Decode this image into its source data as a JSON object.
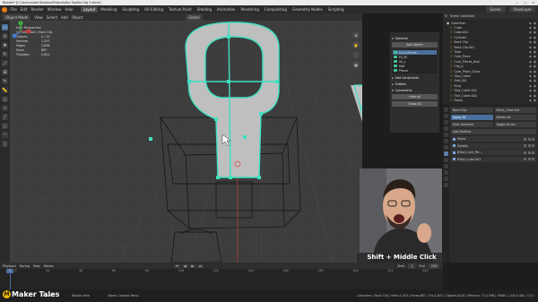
{
  "titlebar": {
    "title": "Blender* [C:\\Users\\maker\\Dropbox\\Projects\\Key Tag\\Key Tag 2.blend]",
    "controls": [
      "—",
      "▢",
      "✕"
    ]
  },
  "menubar": {
    "menus": [
      "File",
      "Edit",
      "Render",
      "Window",
      "Help"
    ],
    "workspaces": [
      "Layout",
      "Modeling",
      "Sculpting",
      "UV Editing",
      "Texture Paint",
      "Shading",
      "Animation",
      "Rendering",
      "Compositing",
      "Geometry Nodes",
      "Scripting"
    ],
    "active_workspace": "Layout",
    "scene_label": "Scene",
    "view_layer_label": "ViewLayer"
  },
  "viewport_header": {
    "mode": "Object Mode",
    "menus": [
      "View",
      "Select",
      "Add",
      "Object"
    ],
    "orientation": "Global"
  },
  "viewport": {
    "view_name": "User Perspective",
    "collection": "(1) Collection | Back Clip",
    "stats": [
      {
        "label": "Objects",
        "value": "0 / 10"
      },
      {
        "label": "Vertices",
        "value": "1,553"
      },
      {
        "label": "Edges",
        "value": "2,636"
      },
      {
        "label": "Faces",
        "value": "887"
      },
      {
        "label": "Triangles",
        "value": "2,622"
      }
    ],
    "nav_buttons": [
      "⊕",
      "✋",
      "🎥",
      "▦"
    ],
    "gizmo_axes": [
      "X",
      "Y",
      "Z"
    ]
  },
  "sketch_panel": {
    "header": "Sketcher",
    "add_button": "Add Sketch",
    "sketches": [
      {
        "name": "Cure_Pieces",
        "color": "#3fbf8f",
        "selected": true
      },
      {
        "name": "Fil_Sk",
        "color": "#3fbf8f",
        "selected": false
      },
      {
        "name": "Sk_s",
        "color": "#3fbf8f",
        "selected": false
      },
      {
        "name": "Hall",
        "color": "#3fbf8f",
        "selected": false
      },
      {
        "name": "Pierce",
        "color": "#3fbf8f",
        "selected": false
      }
    ],
    "sections": [
      "Add Constraints",
      "Entities",
      "Constraints"
    ],
    "buttons": [
      "Hide all",
      "Show All"
    ]
  },
  "outliner": {
    "header": "Scene Collection",
    "items": [
      {
        "name": "Collection",
        "indent": 1
      },
      {
        "name": "Cube",
        "indent": 2
      },
      {
        "name": "Cube.001",
        "indent": 2
      },
      {
        "name": "Cylinder",
        "indent": 2
      },
      {
        "name": "Back Clip",
        "indent": 2
      },
      {
        "name": "Back Clip.001",
        "indent": 2
      },
      {
        "name": "Tube",
        "indent": 2
      },
      {
        "name": "Core_Piece",
        "indent": 2
      },
      {
        "name": "Cure_Pieces_Bool",
        "indent": 2
      },
      {
        "name": "Clip_b",
        "indent": 2
      },
      {
        "name": "Core_Piece_Clone",
        "indent": 2
      },
      {
        "name": "Slot_Cutter",
        "indent": 2
      },
      {
        "name": "Add_001",
        "indent": 2
      },
      {
        "name": "Ring",
        "indent": 2
      },
      {
        "name": "Slot_Cutter.001",
        "indent": 2
      },
      {
        "name": "Slot_Cutter.002",
        "indent": 2
      },
      {
        "name": "Ramp",
        "indent": 2
      }
    ]
  },
  "properties": {
    "object_name": "Back Clip",
    "target_name": "BTool_Cube.001",
    "fields": [
      "Apply All",
      "Delete All",
      "Hide Selected",
      "Toggle Brush"
    ],
    "add_modifier": "Add Modifier",
    "modifiers": [
      "Mirror",
      "Solidify",
      "BTool_Core_Pie...",
      "BTool_Cube.001"
    ]
  },
  "webcam": {
    "caption": "Shift + Middle Click"
  },
  "timeline": {
    "menus": [
      "Playback",
      "Keying",
      "View",
      "Marker"
    ],
    "current_frame": "1",
    "start_label": "Start",
    "start_value": "1",
    "end_label": "End",
    "end_value": "250",
    "ruler": [
      "0",
      "20",
      "40",
      "60",
      "80",
      "100",
      "120",
      "140",
      "160",
      "180",
      "200",
      "220",
      "240"
    ]
  },
  "statusbar": {
    "select": "Select",
    "rotate": "Rotate View",
    "context_menu": "Object Context Menu",
    "stats": "Collection | Back Clip | Verts:1,553 | Faces:887 | Tris:2,622 | Objects:0/10 | Memory: 73.4 MiB | VRAM: 1.2/8.0 GiB | 3.3.1"
  },
  "branding": {
    "logo_letter": "M",
    "logo_text": "Maker Tales"
  },
  "colors": {
    "sketch_accent": "#3fe0c0",
    "selection_blue": "#4a6f9c",
    "object_orange": "#e8a14a",
    "logo_yellow": "#f0b400"
  }
}
